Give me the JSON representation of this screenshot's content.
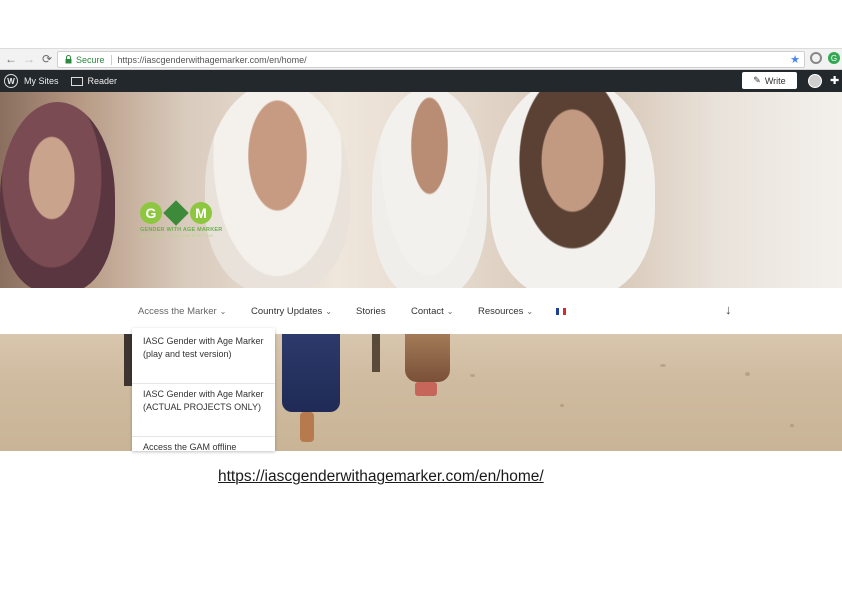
{
  "browser": {
    "secure_label": "Secure",
    "url": "https://iascgenderwithagemarker.com/en/home/"
  },
  "adminbar": {
    "my_sites": "My Sites",
    "reader": "Reader",
    "write": "Write"
  },
  "brand": {
    "letters": [
      "G",
      "M"
    ],
    "tagline": "GENDER WITH AGE MARKER",
    "subline": "BUILDING INCLUSIVE AND EFFECTIVE"
  },
  "nav": {
    "items": [
      {
        "label": "Access the Marker",
        "has_menu": true
      },
      {
        "label": "Country Updates",
        "has_menu": true
      },
      {
        "label": "Stories",
        "has_menu": false
      },
      {
        "label": "Contact",
        "has_menu": true
      },
      {
        "label": "Resources",
        "has_menu": true
      }
    ],
    "chevron": "⌄",
    "flag_colors": [
      "#1f3f99",
      "#ffffff",
      "#d62b2b"
    ],
    "scroll_icon": "↓"
  },
  "dropdown": {
    "items": [
      "IASC Gender with Age Marker (play and test version)",
      "IASC Gender with Age Marker (ACTUAL PROJECTS ONLY)",
      "Access the GAM offline"
    ]
  },
  "caption": {
    "link_text": "https://iascgenderwithagemarker.com/en/home/"
  },
  "colors": {
    "adminbar_bg": "#23282d",
    "brand_green": "#8dc63f",
    "secure_green": "#2b8a3e",
    "star_blue": "#4a86e8"
  }
}
